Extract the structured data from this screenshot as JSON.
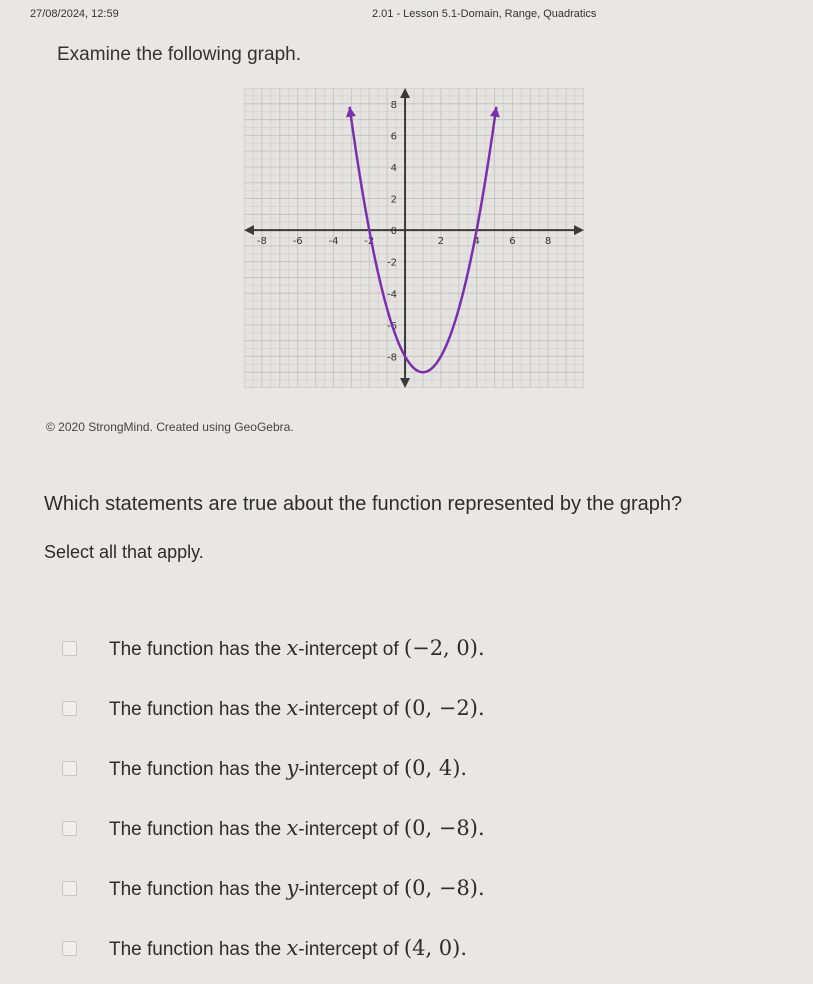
{
  "header": {
    "date": "27/08/2024, 12:59",
    "lesson": "2.01 - Lesson 5.1-Domain, Range, Quadratics"
  },
  "prompt": "Examine the following graph.",
  "credit": "© 2020 StrongMind. Created using GeoGebra.",
  "question": "Which statements are true about the function represented by the graph?",
  "instruction": "Select all that apply.",
  "options": [
    {
      "text": "The function has the ",
      "var": "x",
      "suffix": "-intercept of ",
      "point": "(−2, 0)."
    },
    {
      "text": "The function has the ",
      "var": "x",
      "suffix": "-intercept of ",
      "point": "(0, −2)."
    },
    {
      "text": "The function has the ",
      "var": "y",
      "suffix": "-intercept of ",
      "point": "(0, 4)."
    },
    {
      "text": "The function has the ",
      "var": "x",
      "suffix": "-intercept of ",
      "point": "(0, −8)."
    },
    {
      "text": "The function has the ",
      "var": "y",
      "suffix": "-intercept of ",
      "point": "(0, −8)."
    },
    {
      "text": "The function has the ",
      "var": "x",
      "suffix": "-intercept of ",
      "point": "(4, 0)."
    }
  ],
  "chart_data": {
    "type": "line",
    "title": "",
    "xlabel": "",
    "ylabel": "",
    "xlim": [
      -9,
      10
    ],
    "ylim": [
      -10,
      9
    ],
    "grid": true,
    "x_ticks": [
      "-8",
      "-6",
      "-4",
      "-2",
      "2",
      "4",
      "6",
      "8"
    ],
    "y_ticks": [
      "8",
      "6",
      "4",
      "2",
      "0",
      "-2",
      "-4",
      "-6",
      "-8"
    ],
    "series": [
      {
        "function": "y = (x + 2)(x - 4)",
        "x": [
          -3.1,
          -2,
          -1,
          0,
          1,
          2,
          3,
          4,
          5.1
        ],
        "y": [
          7.9,
          0,
          -5,
          -8,
          -9,
          -8,
          -5,
          0,
          7.9
        ],
        "color": "#7a2fb0"
      }
    ]
  }
}
